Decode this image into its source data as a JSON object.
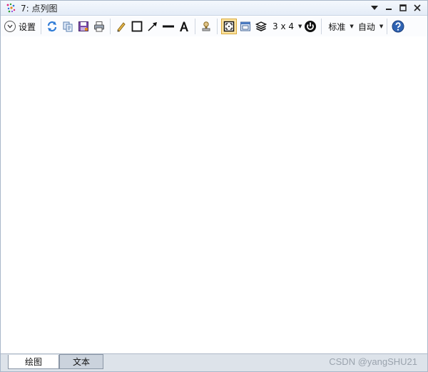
{
  "window": {
    "title": "7: 点列图"
  },
  "toolbar": {
    "settings_label": "设置",
    "layout_label": "3 x 4",
    "standard_label": "标准",
    "auto_label": "自动"
  },
  "tabs": [
    {
      "label": "绘图",
      "active": true
    },
    {
      "label": "文本",
      "active": false
    }
  ],
  "watermark": "CSDN @yangSHU21",
  "colors": {
    "titlebar": "#e4ecf7",
    "selected": "#fbe3a0",
    "help": "#2f63b3"
  }
}
